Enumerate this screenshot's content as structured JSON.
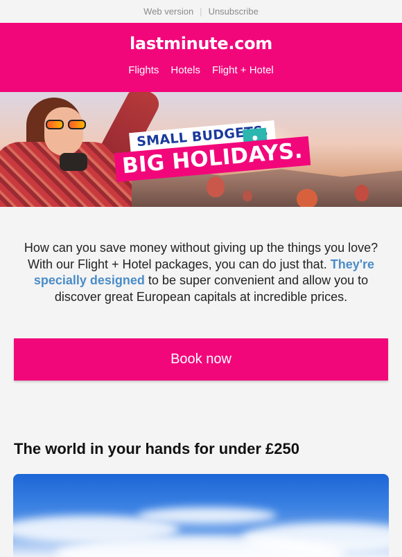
{
  "topbar": {
    "web_version": "Web version",
    "separator": "|",
    "unsubscribe": "Unsubscribe"
  },
  "header": {
    "logo": "lastminute.com",
    "nav": [
      {
        "label": "Flights"
      },
      {
        "label": "Hotels"
      },
      {
        "label": "Flight + Hotel"
      }
    ]
  },
  "hero": {
    "line1": "SMALL BUDGETS,",
    "line2": "BIG HOLIDAYS.",
    "icon": "piggy-bank-icon"
  },
  "intro": {
    "before": "How can you save money without giving up the things you love? With our Flight + Hotel packages, you can do just that. ",
    "highlight": "They're specially designed",
    "after": " to be super convenient and allow you to discover great European capitals at incredible prices."
  },
  "cta": {
    "label": "Book now"
  },
  "section": {
    "title": "The world in your hands for under £250"
  },
  "colors": {
    "brand": "#f2077b",
    "link": "#4a8cc9",
    "background": "#f4f4f4"
  }
}
